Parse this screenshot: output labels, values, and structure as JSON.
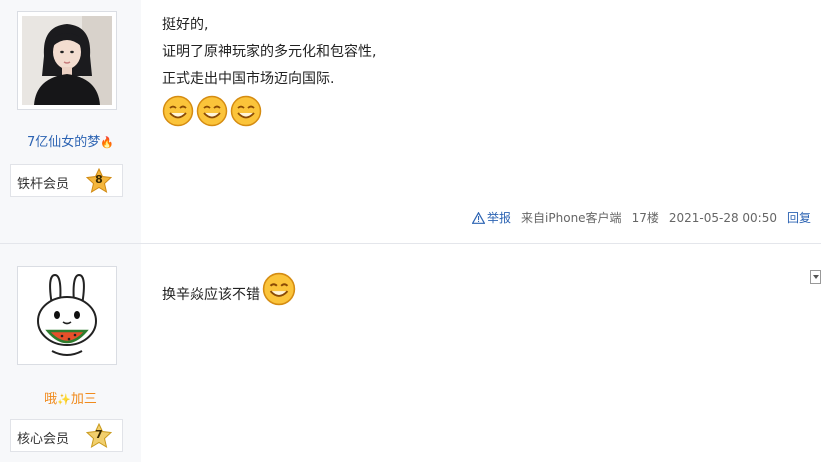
{
  "posts": [
    {
      "user": {
        "name": "7亿仙女的梦",
        "name_deco": "🔥",
        "avatar": "woman-portrait-photo"
      },
      "level": {
        "name": "铁杆会员",
        "number": "8"
      },
      "lines": [
        "挺好的,",
        "证明了原神玩家的多元化和包容性,",
        "正式走出中国市场迈向国际."
      ],
      "emojis": [
        "smile-emoji",
        "smile-emoji",
        "smile-emoji"
      ],
      "meta": {
        "report": "举报",
        "source": "来自iPhone客户端",
        "floor": "17楼",
        "time": "2021-05-28 00:50",
        "reply": "回复"
      }
    },
    {
      "user": {
        "name": "哦",
        "name_suffix": "加三",
        "name_deco": "✨",
        "avatar": "rabbit-cartoon-eating-watermelon"
      },
      "level": {
        "name": "核心会员",
        "number": "7"
      },
      "lines": [
        "换辛焱应该不错"
      ],
      "emojis": [
        "smile-emoji"
      ]
    }
  ],
  "colors": {
    "link": "#2d64b3",
    "sidebar_bg": "#f7f8fa",
    "username_orange": "#f08a1c"
  }
}
